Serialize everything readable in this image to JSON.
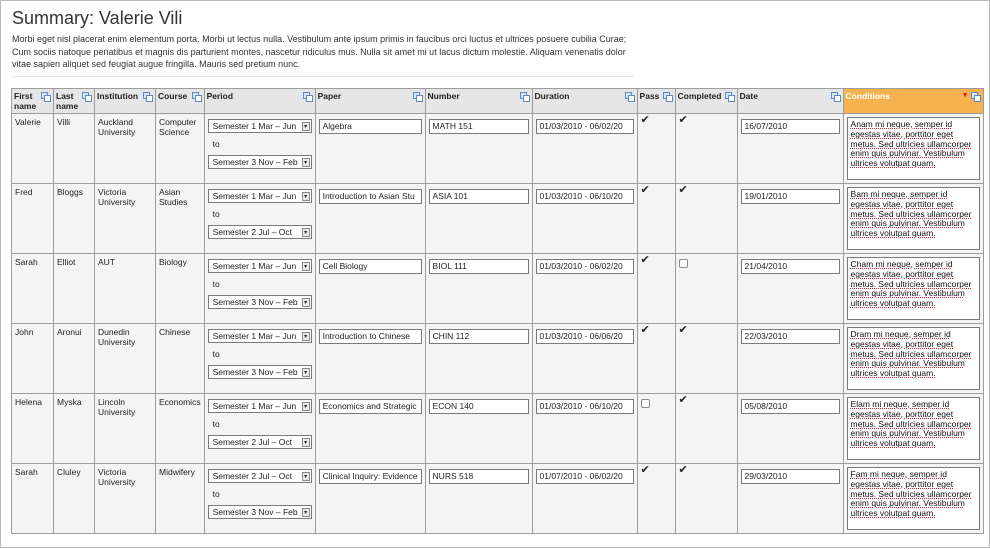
{
  "page": {
    "title": "Summary: Valerie Vili",
    "intro": "Morbi eget nisl placerat enim elementum porta. Morbi ut lectus nulla. Vestibulum ante ipsum primis in faucibus orci luctus et ultrices posuere cubilia Curae; Cum sociis natoque penatibus et magnis dis parturient montes, nascetur ridiculus mus. Nulla sit amet mi ut lacus dictum molestie. Aliquam venenatis dolor vitae sapien aliquet sed feugiat augue fringilla. Mauris sed pretium nunc."
  },
  "table": {
    "headers": [
      "First name",
      "Last name",
      "Institution",
      "Course",
      "Period",
      "Paper",
      "Number",
      "Duration",
      "Pass",
      "Completed",
      "Date",
      "Conditions"
    ],
    "sorted_column": "Conditions",
    "period_to_label": "to",
    "header_icon": "copy-icon",
    "sort_icon": "sort-desc-icon",
    "active_color": "#f6b24f",
    "rows": [
      {
        "first": "Valerie",
        "last": "Villi",
        "institution": "Auckland University",
        "course": "Computer Science",
        "period_from": "Semester 1 Mar – Jun",
        "period_to": "Semester 3 Nov – Feb",
        "paper": "Algebra",
        "number": "MATH 151",
        "duration": "01/03/2010 - 06/02/20",
        "pass": true,
        "completed": true,
        "date": "16/07/2010",
        "conditions": "Anam mi neque, semper id egestas vitae, porttitor eget metus. Sed ultricies ullamcorper enim quis pulvinar. Vestibulum ultrices volutpat quam."
      },
      {
        "first": "Fred",
        "last": "Bloggs",
        "institution": "Victoria University",
        "course": "Asian Studies",
        "period_from": "Semester 1 Mar – Jun",
        "period_to": "Semester 2 Jul – Oct",
        "paper": "Introduction to Asian Stu",
        "number": "ASIA 101",
        "duration": "01/03/2010 - 06/10/20",
        "pass": true,
        "completed": true,
        "date": "19/01/2010",
        "conditions": "Bam mi neque, semper id egestas vitae, porttitor eget metus. Sed ultricies ullamcorper enim quis pulvinar. Vestibulum ultrices volutpat quam."
      },
      {
        "first": "Sarah",
        "last": "Elliot",
        "institution": "AUT",
        "course": "Biology",
        "period_from": "Semester 1 Mar – Jun",
        "period_to": "Semester 3 Nov – Feb",
        "paper": "Cell Biology",
        "number": "BIOL 111",
        "duration": "01/03/2010 - 06/02/20",
        "pass": true,
        "completed": false,
        "date": "21/04/2010",
        "conditions": "Cham mi neque, semper id egestas vitae, porttitor eget metus. Sed ultricies ullamcorper enim quis pulvinar. Vestibulum ultrices volutpat quam."
      },
      {
        "first": "John",
        "last": "Aronui",
        "institution": "Dunedin University",
        "course": "Chinese",
        "period_from": "Semester 1 Mar – Jun",
        "period_to": "Semester 3 Nov – Feb",
        "paper": "Introduction to Chinese",
        "number": "CHIN 112",
        "duration": "01/03/2010 - 06/06/20",
        "pass": true,
        "completed": true,
        "date": "22/03/2010",
        "conditions": "Dram mi neque, semper id egestas vitae, porttitor eget metus. Sed ultricies ullamcorper enim quis pulvinar. Vestibulum ultrices volutpat quam."
      },
      {
        "first": "Helena",
        "last": "Myska",
        "institution": "Lincoln University",
        "course": "Economics",
        "period_from": "Semester 1 Mar – Jun",
        "period_to": "Semester 2 Jul – Oct",
        "paper": "Economics and Strategic",
        "number": "ECON 140",
        "duration": "01/03/2010 - 06/10/20",
        "pass": false,
        "completed": true,
        "date": "05/08/2010",
        "conditions": "Elam mi neque, semper id egestas vitae, porttitor eget metus. Sed ultricies ullamcorper enim quis pulvinar. Vestibulum ultrices volutpat quam."
      },
      {
        "first": "Sarah",
        "last": "Cluley",
        "institution": "Victoria University",
        "course": "Midwifery",
        "period_from": "Semester 2 Jul – Oct",
        "period_to": "Semester 3 Nov – Feb",
        "paper": "Clinical Inquiry: Evidence",
        "number": "NURS 518",
        "duration": "01/07/2010 - 06/02/20",
        "pass": true,
        "completed": true,
        "date": "29/03/2010",
        "conditions": "Fam mi neque, semper id egestas vitae, porttitor eget metus. Sed ultricies ullamcorper enim quis pulvinar. Vestibulum ultrices volutpat quam."
      }
    ]
  }
}
